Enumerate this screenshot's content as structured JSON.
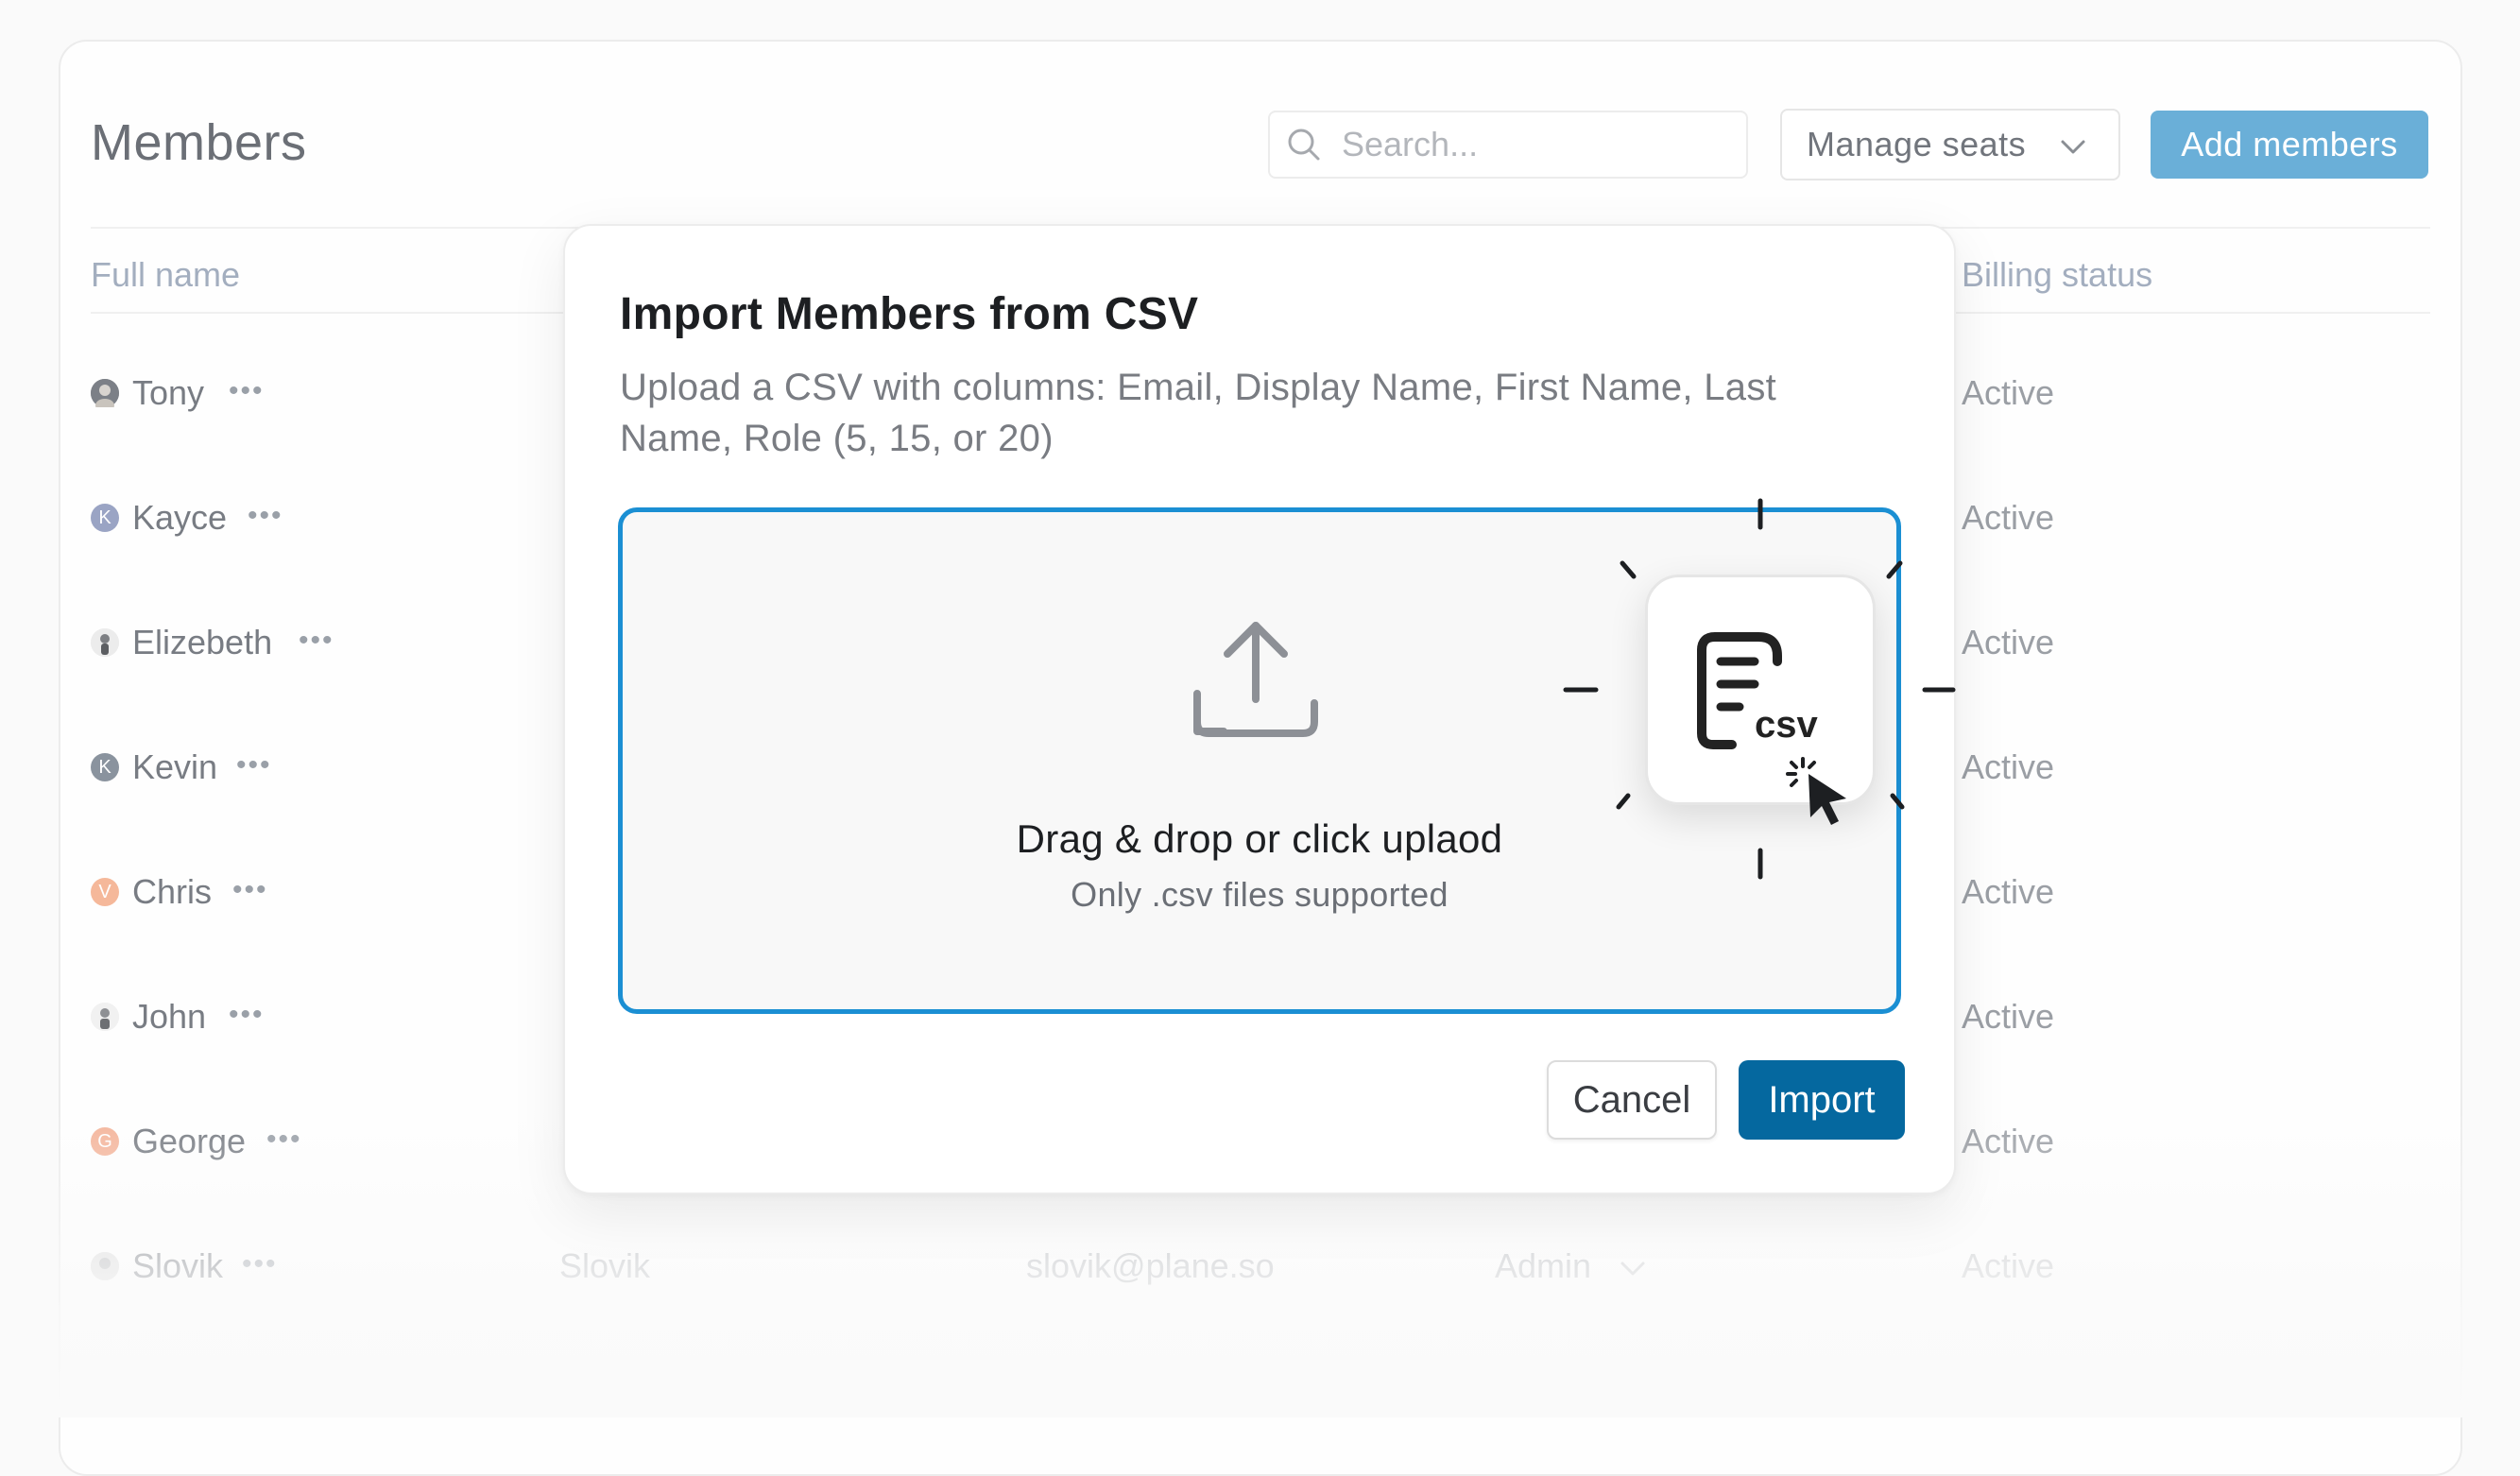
{
  "page": {
    "title": "Members",
    "search_placeholder": "Search...",
    "manage_seats_label": "Manage seats",
    "add_members_label": "Add members"
  },
  "table": {
    "columns": {
      "full_name": "Full name",
      "billing_status": "Billing status"
    },
    "rows": [
      {
        "name": "Tony",
        "avatar": "photo",
        "status": "Active"
      },
      {
        "name": "Kayce",
        "avatar_letter": "K",
        "avatar_color": "#9aa4c4",
        "status": "Active"
      },
      {
        "name": "Elizebeth",
        "avatar": "photo",
        "status": "Active"
      },
      {
        "name": "Kevin",
        "avatar_letter": "K",
        "avatar_color": "#8a939e",
        "status": "Active"
      },
      {
        "name": "Chris",
        "avatar_letter": "V",
        "avatar_color": "#f5b89a",
        "status": "Active"
      },
      {
        "name": "John",
        "avatar": "photo",
        "status": "Active"
      },
      {
        "name": "George",
        "avatar_letter": "G",
        "avatar_color": "#f4b49a",
        "status": "Active"
      },
      {
        "name": "Slovik",
        "avatar": "photo",
        "display_name": "Slovik",
        "email": "slovik@plane.so",
        "role": "Admin",
        "status": "Active"
      }
    ]
  },
  "modal": {
    "title": "Import Members from CSV",
    "description": "Upload a CSV with columns: Email, Display Name, First Name, Last Name, Role (5, 15, or 20)",
    "dropzone_title": "Drag & drop or click uplaod",
    "dropzone_subtitle": "Only .csv files supported",
    "csv_badge_text": "csv",
    "cancel_label": "Cancel",
    "import_label": "Import"
  },
  "colors": {
    "accent": "#1b8fd3",
    "import_button": "#05689f",
    "add_members_button": "#6aafd8"
  },
  "icons": [
    "search-icon",
    "chevron-down-icon",
    "more-icon",
    "upload-icon",
    "csv-file-icon",
    "cursor-click-icon"
  ]
}
